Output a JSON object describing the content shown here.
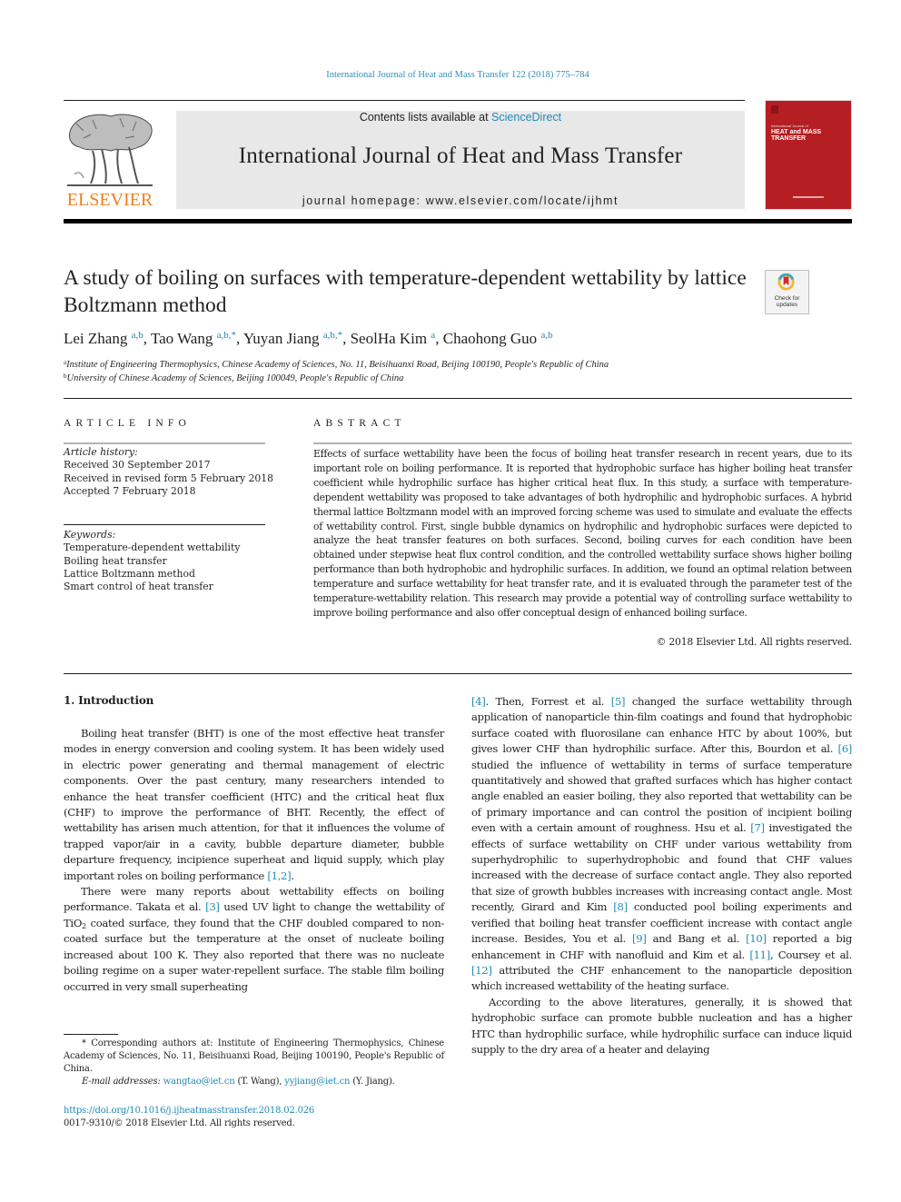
{
  "running_head": "International Journal of Heat and Mass Transfer 122 (2018) 775–784",
  "masthead": {
    "contents_prefix": "Contents lists available at ",
    "contents_link": "ScienceDirect",
    "journal_name": "International Journal of Heat and Mass Transfer",
    "homepage": "journal homepage: www.elsevier.com/locate/ijhmt",
    "publisher_logo": "ELSEVIER",
    "cover": {
      "small": "International Journal of",
      "line1": "HEAT and MASS",
      "line2": "TRANSFER",
      "color": "#b51e23"
    }
  },
  "article": {
    "title": "A study of boiling on surfaces with temperature-dependent wettability by lattice Boltzmann method",
    "crossmark_label_1": "Check for",
    "crossmark_label_2": "updates",
    "authors": [
      {
        "name": "Lei Zhang",
        "sup": "a,b"
      },
      {
        "name": "Tao Wang",
        "sup": "a,b,*"
      },
      {
        "name": "Yuyan Jiang",
        "sup": "a,b,*"
      },
      {
        "name": "SeolHa Kim",
        "sup": "a"
      },
      {
        "name": "Chaohong Guo",
        "sup": "a,b"
      }
    ],
    "affiliations": [
      {
        "mark": "a",
        "text": "Institute of Engineering Thermophysics, Chinese Academy of Sciences, No. 11, Beisihuanxi Road, Beijing 100190, People's Republic of China"
      },
      {
        "mark": "b",
        "text": "University of Chinese Academy of Sciences, Beijing 100049, People's Republic of China"
      }
    ]
  },
  "article_info": {
    "heading": "ARTICLE INFO",
    "history_label": "Article history:",
    "history": [
      "Received 30 September 2017",
      "Received in revised form 5 February 2018",
      "Accepted 7 February 2018"
    ],
    "keywords_label": "Keywords:",
    "keywords": [
      "Temperature-dependent wettability",
      "Boiling heat transfer",
      "Lattice Boltzmann method",
      "Smart control of heat transfer"
    ]
  },
  "abstract": {
    "heading": "ABSTRACT",
    "text": "Effects of surface wettability have been the focus of boiling heat transfer research in recent years, due to its important role on boiling performance. It is reported that hydrophobic surface has higher boiling heat transfer coefficient while hydrophilic surface has higher critical heat flux. In this study, a surface with temperature-dependent wettability was proposed to take advantages of both hydrophilic and hydrophobic surfaces. A hybrid thermal lattice Boltzmann model with an improved forcing scheme was used to simulate and evaluate the effects of wettability control. First, single bubble dynamics on hydrophilic and hydrophobic surfaces were depicted to analyze the heat transfer features on both surfaces. Second, boiling curves for each condition have been obtained under stepwise heat flux control condition, and the controlled wettability surface shows higher boiling performance than both hydrophobic and hydrophilic surfaces. In addition, we found an optimal relation between temperature and surface wettability for heat transfer rate, and it is evaluated through the parameter test of the temperature-wettability relation. This research may provide a potential way of controlling surface wettability to improve boiling performance and also offer conceptual design of enhanced boiling surface.",
    "copyright": "© 2018 Elsevier Ltd. All rights reserved."
  },
  "introduction": {
    "heading": "1. Introduction",
    "p1": "Boiling heat transfer (BHT) is one of the most effective heat transfer modes in energy conversion and cooling system. It has been widely used in electric power generating and thermal management of electric components. Over the past century, many researchers intended to enhance the heat transfer coefficient (HTC) and the critical heat flux (CHF) to improve the performance of BHT. Recently, the effect of wettability has arisen much attention, for that it influences the volume of trapped vapor/air in a cavity, bubble departure diameter, bubble departure frequency, incipience superheat and liquid supply, which play important roles on boiling performance ",
    "p1_ref": "[1,2]",
    "p2_a": "There were many reports about wettability effects on boiling performance. Takata et al. ",
    "p2_ref1": "[3]",
    "p2_b": " used UV light to change the wettability of TiO",
    "p2_sub": "2",
    "p2_c": " coated surface, they found that the CHF doubled compared to non-coated surface but the temperature at the onset of nucleate boiling increased about 100 K. They also reported that there was no nucleate boiling regime on a super water-repellent surface. The stable film boiling occurred in very small superheating",
    "r_ref4": "[4]",
    "r_a": ". Then, Forrest et al. ",
    "r_ref5": "[5]",
    "r_b": " changed the surface wettability through application of nanoparticle thin-film coatings and found that hydrophobic surface coated with fluorosilane can enhance HTC by about 100%, but gives lower CHF than hydrophilic surface. After this, Bourdon et al. ",
    "r_ref6": "[6]",
    "r_c": " studied the influence of wettability in terms of surface temperature quantitatively and showed that grafted surfaces which has higher contact angle enabled an easier boiling, they also reported that wettability can be of primary importance and can control the position of incipient boiling even with a certain amount of roughness. Hsu et al. ",
    "r_ref7": "[7]",
    "r_d": " investigated the effects of surface wettability on CHF under various wettability from superhydrophilic to superhydrophobic and found that CHF values increased with the decrease of surface contact angle. They also reported that size of growth bubbles increases with increasing contact angle. Most recently, Girard and Kim ",
    "r_ref8": "[8]",
    "r_e": " conducted pool boiling experiments and verified that boiling heat transfer coefficient increase with contact angle increase. Besides, You et al. ",
    "r_ref9": "[9]",
    "r_f": " and Bang et al. ",
    "r_ref10": "[10]",
    "r_g": " reported a big enhancement in CHF with nanofluid and Kim et al. ",
    "r_ref11": "[11]",
    "r_h": ", Coursey et al. ",
    "r_ref12": "[12]",
    "r_i": " attributed the CHF enhancement to the nanoparticle deposition which increased wettability of the heating surface.",
    "p3": "According to the above literatures, generally, it is showed that hydrophobic surface can promote bubble nucleation and has a higher HTC than hydrophilic surface, while hydrophilic surface can induce liquid supply to the dry area of a heater and delaying"
  },
  "footnotes": {
    "corresponding": "* Corresponding authors at: Institute of Engineering Thermophysics, Chinese Academy of Sciences, No. 11, Beisihuanxi Road, Beijing 100190, People's Republic of China.",
    "email_label": "E-mail addresses: ",
    "email1": "wangtao@iet.cn",
    "email1_who": " (T. Wang), ",
    "email2": "yyjiang@iet.cn",
    "email2_who": " (Y. Jiang).",
    "doi": "https://doi.org/10.1016/j.ijheatmasstransfer.2018.02.026",
    "issn": "0017-9310/© 2018 Elsevier Ltd. All rights reserved."
  },
  "colors": {
    "link": "#1f8ab8",
    "elsevier_orange": "#f07f1f",
    "masthead_bg": "#e8e8e9"
  }
}
